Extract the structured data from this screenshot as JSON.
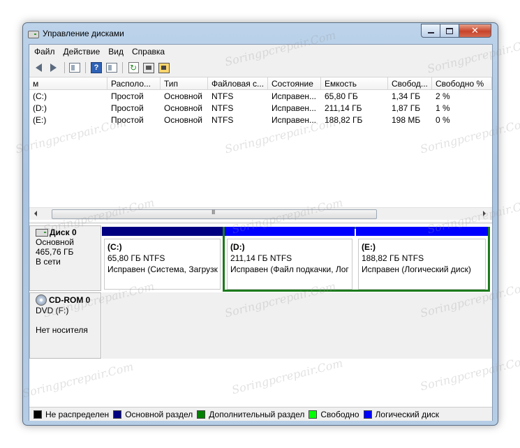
{
  "window": {
    "title": "Управление дисками",
    "controls": [
      "minimize",
      "maximize",
      "close"
    ],
    "close_glyph": "✕"
  },
  "menu": [
    "Файл",
    "Действие",
    "Вид",
    "Справка"
  ],
  "toolbar_icons": [
    "back-arrow-icon",
    "forward-arrow-icon",
    "console-tree-icon",
    "help-icon",
    "show-pane-icon",
    "refresh-icon",
    "properties-icon",
    "settings-icon"
  ],
  "toolbar": {
    "help_glyph": "?",
    "refresh_glyph": "↻"
  },
  "volume_table": {
    "columns": [
      "м",
      "Располо...",
      "Тип",
      "Файловая с...",
      "Состояние",
      "Емкость",
      "Свобод...",
      "Свободно %"
    ],
    "rows": [
      [
        "(C:)",
        "Простой",
        "Основной",
        "NTFS",
        "Исправен...",
        "65,80 ГБ",
        "1,34 ГБ",
        "2 %"
      ],
      [
        "(D:)",
        "Простой",
        "Основной",
        "NTFS",
        "Исправен...",
        "211,14 ГБ",
        "1,87 ГБ",
        "1 %"
      ],
      [
        "(E:)",
        "Простой",
        "Основной",
        "NTFS",
        "Исправен...",
        "188,82 ГБ",
        "198 МБ",
        "0 %"
      ]
    ],
    "scroll_grip": "III"
  },
  "disks": [
    {
      "name": "Диск 0",
      "lines": [
        "Основной",
        "465,76 ГБ",
        "В сети"
      ],
      "partitions": [
        {
          "name": "(C:)",
          "size": "65,80 ГБ NTFS",
          "status": "Исправен (Система, Загрузк",
          "bar_color": "#000080"
        },
        {
          "name": "(D:)",
          "size": "211,14 ГБ NTFS",
          "status": "Исправен (Файл подкачки, Лог",
          "bar_color": "#0000ff"
        },
        {
          "name": "(E:)",
          "size": "188,82 ГБ NTFS",
          "status": "Исправен (Логический диск)",
          "bar_color": "#0000ff"
        }
      ]
    },
    {
      "name": "CD-ROM 0",
      "lines": [
        "DVD (F:)",
        "",
        "Нет носителя"
      ]
    }
  ],
  "legend": [
    {
      "label": "Не распределен",
      "color": "#000000"
    },
    {
      "label": "Основной раздел",
      "color": "#000080"
    },
    {
      "label": "Дополнительный раздел",
      "color": "#008000"
    },
    {
      "label": "Свободно",
      "color": "#00ff00"
    },
    {
      "label": "Логический диск",
      "color": "#0000ff"
    }
  ],
  "colors": {
    "extended_border": "#1c7a1c",
    "title_bar": "#b8cfe8"
  },
  "watermark": "Soringpcrepair.Com"
}
